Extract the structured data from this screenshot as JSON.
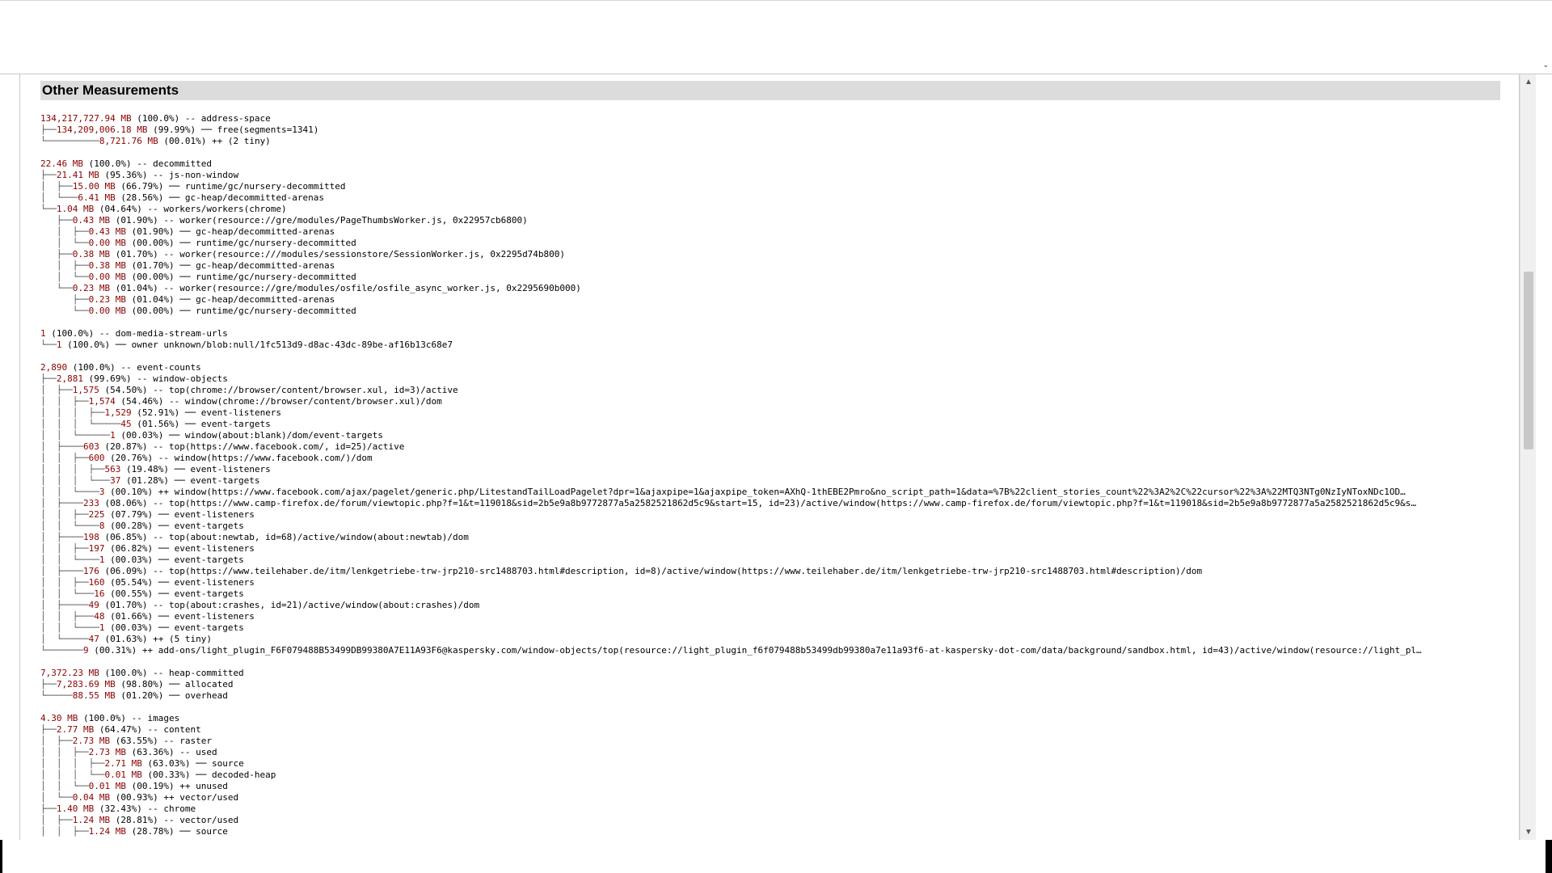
{
  "page": {
    "section_title": "Other Measurements",
    "colors": {
      "value": "#8b0000",
      "header_bg": "#dcdcdc",
      "tree": "#555555"
    }
  },
  "reports": [
    {
      "lines": [
        {
          "prefix": "",
          "value": "134,217,727.94 MB",
          "pct": "(100.0%)",
          "sep": "--",
          "label": "address-space"
        },
        {
          "prefix": "├──",
          "value": "134,209,006.18 MB",
          "pct": "(99.99%)",
          "sep": "──",
          "label": "free(segments=1341)"
        },
        {
          "prefix": "└──────────",
          "value": "8,721.76 MB",
          "pct": "(00.01%)",
          "sep": "++",
          "label": "(2 tiny)"
        }
      ]
    },
    {
      "lines": [
        {
          "prefix": "",
          "value": "22.46 MB",
          "pct": "(100.0%)",
          "sep": "--",
          "label": "decommitted"
        },
        {
          "prefix": "├──",
          "value": "21.41 MB",
          "pct": "(95.36%)",
          "sep": "--",
          "label": "js-non-window"
        },
        {
          "prefix": "│  ├──",
          "value": "15.00 MB",
          "pct": "(66.79%)",
          "sep": "──",
          "label": "runtime/gc/nursery-decommitted"
        },
        {
          "prefix": "│  └───",
          "value": "6.41 MB",
          "pct": "(28.56%)",
          "sep": "──",
          "label": "gc-heap/decommitted-arenas"
        },
        {
          "prefix": "└──",
          "value": "1.04 MB",
          "pct": "(04.64%)",
          "sep": "--",
          "label": "workers/workers(chrome)"
        },
        {
          "prefix": "   ├──",
          "value": "0.43 MB",
          "pct": "(01.90%)",
          "sep": "--",
          "label": "worker(resource://gre/modules/PageThumbsWorker.js, 0x22957cb6800)"
        },
        {
          "prefix": "   │  ├──",
          "value": "0.43 MB",
          "pct": "(01.90%)",
          "sep": "──",
          "label": "gc-heap/decommitted-arenas"
        },
        {
          "prefix": "   │  └──",
          "value": "0.00 MB",
          "pct": "(00.00%)",
          "sep": "──",
          "label": "runtime/gc/nursery-decommitted"
        },
        {
          "prefix": "   ├──",
          "value": "0.38 MB",
          "pct": "(01.70%)",
          "sep": "--",
          "label": "worker(resource:///modules/sessionstore/SessionWorker.js, 0x2295d74b800)"
        },
        {
          "prefix": "   │  ├──",
          "value": "0.38 MB",
          "pct": "(01.70%)",
          "sep": "──",
          "label": "gc-heap/decommitted-arenas"
        },
        {
          "prefix": "   │  └──",
          "value": "0.00 MB",
          "pct": "(00.00%)",
          "sep": "──",
          "label": "runtime/gc/nursery-decommitted"
        },
        {
          "prefix": "   └──",
          "value": "0.23 MB",
          "pct": "(01.04%)",
          "sep": "--",
          "label": "worker(resource://gre/modules/osfile/osfile_async_worker.js, 0x2295690b000)"
        },
        {
          "prefix": "      ├──",
          "value": "0.23 MB",
          "pct": "(01.04%)",
          "sep": "──",
          "label": "gc-heap/decommitted-arenas"
        },
        {
          "prefix": "      └──",
          "value": "0.00 MB",
          "pct": "(00.00%)",
          "sep": "──",
          "label": "runtime/gc/nursery-decommitted"
        }
      ]
    },
    {
      "lines": [
        {
          "prefix": "",
          "value": "1",
          "pct": "(100.0%)",
          "sep": "--",
          "label": "dom-media-stream-urls"
        },
        {
          "prefix": "└──",
          "value": "1",
          "pct": "(100.0%)",
          "sep": "──",
          "label": "owner unknown/blob:null/1fc513d9-d8ac-43dc-89be-af16b13c68e7"
        }
      ]
    },
    {
      "lines": [
        {
          "prefix": "",
          "value": "2,890",
          "pct": "(100.0%)",
          "sep": "--",
          "label": "event-counts"
        },
        {
          "prefix": "├──",
          "value": "2,881",
          "pct": "(99.69%)",
          "sep": "--",
          "label": "window-objects"
        },
        {
          "prefix": "│  ├──",
          "value": "1,575",
          "pct": "(54.50%)",
          "sep": "--",
          "label": "top(chrome://browser/content/browser.xul, id=3)/active"
        },
        {
          "prefix": "│  │  ├──",
          "value": "1,574",
          "pct": "(54.46%)",
          "sep": "--",
          "label": "window(chrome://browser/content/browser.xul)/dom"
        },
        {
          "prefix": "│  │  │  ├──",
          "value": "1,529",
          "pct": "(52.91%)",
          "sep": "──",
          "label": "event-listeners"
        },
        {
          "prefix": "│  │  │  └─────",
          "value": "45",
          "pct": "(01.56%)",
          "sep": "──",
          "label": "event-targets"
        },
        {
          "prefix": "│  │  └──────",
          "value": "1",
          "pct": "(00.03%)",
          "sep": "──",
          "label": "window(about:blank)/dom/event-targets"
        },
        {
          "prefix": "│  ├────",
          "value": "603",
          "pct": "(20.87%)",
          "sep": "--",
          "label": "top(https://www.facebook.com/, id=25)/active"
        },
        {
          "prefix": "│  │  ├──",
          "value": "600",
          "pct": "(20.76%)",
          "sep": "--",
          "label": "window(https://www.facebook.com/)/dom"
        },
        {
          "prefix": "│  │  │  ├──",
          "value": "563",
          "pct": "(19.48%)",
          "sep": "──",
          "label": "event-listeners"
        },
        {
          "prefix": "│  │  │  └───",
          "value": "37",
          "pct": "(01.28%)",
          "sep": "──",
          "label": "event-targets"
        },
        {
          "prefix": "│  │  └────",
          "value": "3",
          "pct": "(00.10%)",
          "sep": "++",
          "label": "window(https://www.facebook.com/ajax/pagelet/generic.php/LitestandTailLoadPagelet?dpr=1&ajaxpipe=1&ajaxpipe_token=AXhQ-1thEBE2Pmro&no_script_path=1&data=%7B%22client_stories_count%22%3A2%2C%22cursor%22%3A%22MTQ3NTg0NzIyNToxNDc1OD…"
        },
        {
          "prefix": "│  ├────",
          "value": "233",
          "pct": "(08.06%)",
          "sep": "--",
          "label": "top(https://www.camp-firefox.de/forum/viewtopic.php?f=1&t=119018&sid=2b5e9a8b9772877a5a2582521862d5c9&start=15, id=23)/active/window(https://www.camp-firefox.de/forum/viewtopic.php?f=1&t=119018&sid=2b5e9a8b9772877a5a2582521862d5c9&s…"
        },
        {
          "prefix": "│  │  ├──",
          "value": "225",
          "pct": "(07.79%)",
          "sep": "──",
          "label": "event-listeners"
        },
        {
          "prefix": "│  │  └────",
          "value": "8",
          "pct": "(00.28%)",
          "sep": "──",
          "label": "event-targets"
        },
        {
          "prefix": "│  ├────",
          "value": "198",
          "pct": "(06.85%)",
          "sep": "--",
          "label": "top(about:newtab, id=68)/active/window(about:newtab)/dom"
        },
        {
          "prefix": "│  │  ├──",
          "value": "197",
          "pct": "(06.82%)",
          "sep": "──",
          "label": "event-listeners"
        },
        {
          "prefix": "│  │  └────",
          "value": "1",
          "pct": "(00.03%)",
          "sep": "──",
          "label": "event-targets"
        },
        {
          "prefix": "│  ├────",
          "value": "176",
          "pct": "(06.09%)",
          "sep": "--",
          "label": "top(https://www.teilehaber.de/itm/lenkgetriebe-trw-jrp210-src1488703.html#description, id=8)/active/window(https://www.teilehaber.de/itm/lenkgetriebe-trw-jrp210-src1488703.html#description)/dom"
        },
        {
          "prefix": "│  │  ├──",
          "value": "160",
          "pct": "(05.54%)",
          "sep": "──",
          "label": "event-listeners"
        },
        {
          "prefix": "│  │  └───",
          "value": "16",
          "pct": "(00.55%)",
          "sep": "──",
          "label": "event-targets"
        },
        {
          "prefix": "│  ├─────",
          "value": "49",
          "pct": "(01.70%)",
          "sep": "--",
          "label": "top(about:crashes, id=21)/active/window(about:crashes)/dom"
        },
        {
          "prefix": "│  │  ├───",
          "value": "48",
          "pct": "(01.66%)",
          "sep": "──",
          "label": "event-listeners"
        },
        {
          "prefix": "│  │  └────",
          "value": "1",
          "pct": "(00.03%)",
          "sep": "──",
          "label": "event-targets"
        },
        {
          "prefix": "│  └─────",
          "value": "47",
          "pct": "(01.63%)",
          "sep": "++",
          "label": "(5 tiny)"
        },
        {
          "prefix": "└───────",
          "value": "9",
          "pct": "(00.31%)",
          "sep": "++",
          "label": "add-ons/light_plugin_F6F079488B53499DB99380A7E11A93F6@kaspersky.com/window-objects/top(resource://light_plugin_f6f079488b53499db99380a7e11a93f6-at-kaspersky-dot-com/data/background/sandbox.html, id=43)/active/window(resource://light_pl…"
        }
      ]
    },
    {
      "lines": [
        {
          "prefix": "",
          "value": "7,372.23 MB",
          "pct": "(100.0%)",
          "sep": "--",
          "label": "heap-committed"
        },
        {
          "prefix": "├──",
          "value": "7,283.69 MB",
          "pct": "(98.80%)",
          "sep": "──",
          "label": "allocated"
        },
        {
          "prefix": "└─────",
          "value": "88.55 MB",
          "pct": "(01.20%)",
          "sep": "──",
          "label": "overhead"
        }
      ]
    },
    {
      "lines": [
        {
          "prefix": "",
          "value": "4.30 MB",
          "pct": "(100.0%)",
          "sep": "--",
          "label": "images"
        },
        {
          "prefix": "├──",
          "value": "2.77 MB",
          "pct": "(64.47%)",
          "sep": "--",
          "label": "content"
        },
        {
          "prefix": "│  ├──",
          "value": "2.73 MB",
          "pct": "(63.55%)",
          "sep": "--",
          "label": "raster"
        },
        {
          "prefix": "│  │  ├──",
          "value": "2.73 MB",
          "pct": "(63.36%)",
          "sep": "--",
          "label": "used"
        },
        {
          "prefix": "│  │  │  ├──",
          "value": "2.71 MB",
          "pct": "(63.03%)",
          "sep": "──",
          "label": "source"
        },
        {
          "prefix": "│  │  │  └──",
          "value": "0.01 MB",
          "pct": "(00.33%)",
          "sep": "──",
          "label": "decoded-heap"
        },
        {
          "prefix": "│  │  └──",
          "value": "0.01 MB",
          "pct": "(00.19%)",
          "sep": "++",
          "label": "unused"
        },
        {
          "prefix": "│  └──",
          "value": "0.04 MB",
          "pct": "(00.93%)",
          "sep": "++",
          "label": "vector/used"
        },
        {
          "prefix": "├──",
          "value": "1.40 MB",
          "pct": "(32.43%)",
          "sep": "--",
          "label": "chrome"
        },
        {
          "prefix": "│  ├──",
          "value": "1.24 MB",
          "pct": "(28.81%)",
          "sep": "--",
          "label": "vector/used"
        },
        {
          "prefix": "│  │  ├──",
          "value": "1.24 MB",
          "pct": "(28.78%)",
          "sep": "──",
          "label": "source"
        }
      ]
    }
  ]
}
